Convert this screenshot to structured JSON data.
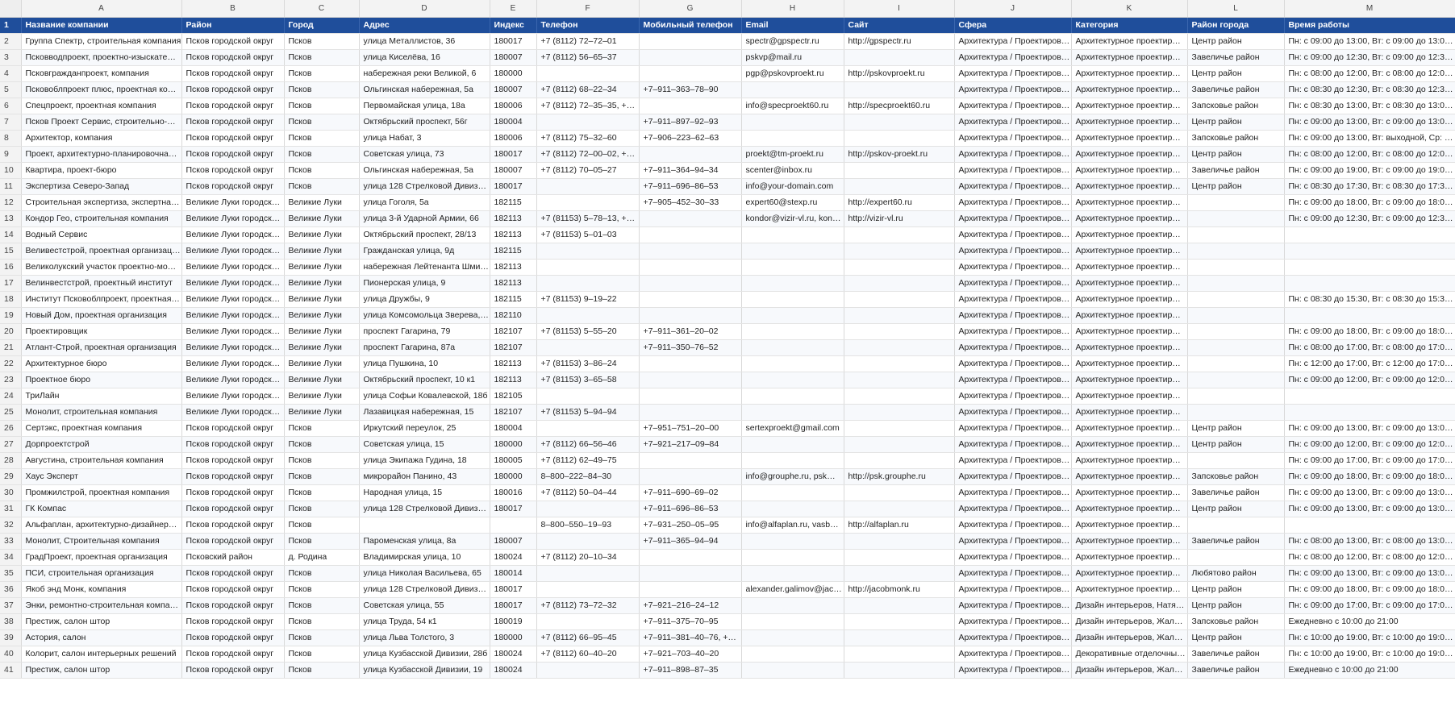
{
  "columns": [
    "A",
    "B",
    "C",
    "D",
    "E",
    "F",
    "G",
    "H",
    "I",
    "J",
    "K",
    "L",
    "M"
  ],
  "header": {
    "row_num": "1",
    "cells": [
      "Название компании",
      "Район",
      "Город",
      "Адрес",
      "Индекс",
      "Телефон",
      "Мобильный телефон",
      "Email",
      "Сайт",
      "Сфера",
      "Категория",
      "Район города",
      "Время работы"
    ]
  },
  "rows": [
    {
      "n": "2",
      "c": [
        "Группа Спектр, строительная компания",
        "Псков городской округ",
        "Псков",
        "улица Металлистов, 36",
        "180017",
        "+7 (8112) 72–72–01",
        "",
        "spectr@gpspectr.ru",
        "http://gpspectr.ru",
        "Архитектура / Проектиров…",
        "Архитектурное проектир…",
        "Центр район",
        "Пн: с 09:00 до 13:00, Вт: с 09:00 до 13:00, С…"
      ]
    },
    {
      "n": "3",
      "c": [
        "Псковводпроект, проектно-изыскате…",
        "Псков городской округ",
        "Псков",
        "улица Киселёва, 16",
        "180007",
        "+7 (8112) 56–65–37",
        "",
        "pskvp@mail.ru",
        "",
        "Архитектура / Проектиров…",
        "Архитектурное проектир…",
        "Завеличье район",
        "Пн: с 09:00 до 12:30, Вт: с 09:00 до 12:30, С…"
      ]
    },
    {
      "n": "4",
      "c": [
        "Псковгражданпроект, компания",
        "Псков городской округ",
        "Псков",
        "набережная реки Великой, 6",
        "180000",
        "",
        "",
        "pgp@pskovproekt.ru",
        "http://pskovproekt.ru",
        "Архитектура / Проектиров…",
        "Архитектурное проектир…",
        "Центр район",
        "Пн: с 08:00 до 12:00, Вт: с 08:00 до 12:00, С…"
      ]
    },
    {
      "n": "5",
      "c": [
        "Псковоблпроект плюс, проектная ко…",
        "Псков городской округ",
        "Псков",
        "Ольгинская набережная, 5а",
        "180007",
        "+7 (8112) 68–22–34",
        "+7–911–363–78–90",
        "",
        "",
        "Архитектура / Проектиров…",
        "Архитектурное проектир…",
        "Завеличье район",
        "Пн: с 08:30 до 12:30, Вт: с 08:30 до 12:30, С…"
      ]
    },
    {
      "n": "6",
      "c": [
        "Спецпроект, проектная компания",
        "Псков городской округ",
        "Псков",
        "Первомайская улица, 18а",
        "180006",
        "+7 (8112) 72–35–35, +7…",
        "",
        "info@specproekt60.ru",
        "http://specproekt60.ru",
        "Архитектура / Проектиров…",
        "Архитектурное проектир…",
        "Запсковье район",
        "Пн: с 08:30 до 13:00, Вт: с 08:30 до 13:00, С…"
      ]
    },
    {
      "n": "7",
      "c": [
        "Псков Проект Сервис, строительно-м…",
        "Псков городской округ",
        "Псков",
        "Октябрьский проспект, 56г",
        "180004",
        "",
        "+7–911–897–92–93",
        "",
        "",
        "Архитектура / Проектиров…",
        "Архитектурное проектир…",
        "Центр район",
        "Пн: с 09:00 до 13:00, Вт: с 09:00 до 13:00, С…"
      ]
    },
    {
      "n": "8",
      "c": [
        "Архитектор, компания",
        "Псков городской округ",
        "Псков",
        "улица Набат, 3",
        "180006",
        "+7 (8112) 75–32–60",
        "+7–906–223–62–63",
        "",
        "",
        "Архитектура / Проектиров…",
        "Архитектурное проектир…",
        "Запсковье район",
        "Пн: с 09:00 до 13:00, Вт: выходной, Ср: с 0…"
      ]
    },
    {
      "n": "9",
      "c": [
        "Проект, архитектурно-планировочна…",
        "Псков городской округ",
        "Псков",
        "Советская улица, 73",
        "180017",
        "+7 (8112) 72–00–02, +7…",
        "",
        "proekt@tm-proekt.ru",
        "http://pskov-proekt.ru",
        "Архитектура / Проектиров…",
        "Архитектурное проектир…",
        "Центр район",
        "Пн: с 08:00 до 12:00, Вт: с 08:00 до 12:00, С…"
      ]
    },
    {
      "n": "10",
      "c": [
        "Квартира, проект-бюро",
        "Псков городской округ",
        "Псков",
        "Ольгинская набережная, 5а",
        "180007",
        "+7 (8112) 70–05–27",
        "+7–911–364–94–34",
        "scenter@inbox.ru",
        "",
        "Архитектура / Проектиров…",
        "Архитектурное проектир…",
        "Завеличье район",
        "Пн: с 09:00 до 19:00, Вт: с 09:00 до 19:00, С…"
      ]
    },
    {
      "n": "11",
      "c": [
        "Экспертиза Северо-Запад",
        "Псков городской округ",
        "Псков",
        "улица 128 Стрелковой Дивизи…",
        "180017",
        "",
        "+7–911–696–86–53",
        "info@your-domain.com",
        "",
        "Архитектура / Проектиров…",
        "Архитектурное проектир…",
        "Центр район",
        "Пн: с 08:30 до 17:30, Вт: с 08:30 до 17:30, С…"
      ]
    },
    {
      "n": "12",
      "c": [
        "Строительная экспертиза, экспертная…",
        "Великие Луки городск…",
        "Великие Луки",
        "улица Гоголя, 5а",
        "182115",
        "",
        "+7–905–452–30–33",
        "expert60@stexp.ru",
        "http://expert60.ru",
        "Архитектура / Проектиров…",
        "Архитектурное проектир…",
        "",
        "Пн: с 09:00 до 18:00, Вт: с 09:00 до 18:00, С…"
      ]
    },
    {
      "n": "13",
      "c": [
        "Кондор Гео, строительная компания",
        "Великие Луки городск…",
        "Великие Луки",
        "улица 3-й Ударной Армии, 66",
        "182113",
        "+7 (81153) 5–78–13, +7…",
        "",
        "kondor@vizir-vl.ru, kon…",
        "http://vizir-vl.ru",
        "Архитектура / Проектиров…",
        "Архитектурное проектир…",
        "",
        "Пн: с 09:00 до 12:30, Вт: с 09:00 до 12:30, С…"
      ]
    },
    {
      "n": "14",
      "c": [
        "Водный Сервис",
        "Великие Луки городск…",
        "Великие Луки",
        "Октябрьский проспект, 28/13",
        "182113",
        "+7 (81153) 5–01–03",
        "",
        "",
        "",
        "Архитектура / Проектиров…",
        "Архитектурное проектир…",
        "",
        ""
      ]
    },
    {
      "n": "15",
      "c": [
        "Веливестстрой, проектная организация",
        "Великие Луки городск…",
        "Великие Луки",
        "Гражданская улица, 9д",
        "182115",
        "",
        "",
        "",
        "",
        "Архитектура / Проектиров…",
        "Архитектурное проектир…",
        "",
        ""
      ]
    },
    {
      "n": "16",
      "c": [
        "Великолукский участок проектно-мо…",
        "Великие Луки городск…",
        "Великие Луки",
        "набережная Лейтенанта Шми…",
        "182113",
        "",
        "",
        "",
        "",
        "Архитектура / Проектиров…",
        "Архитектурное проектир…",
        "",
        ""
      ]
    },
    {
      "n": "17",
      "c": [
        "Велинвестстрой, проектный институт",
        "Великие Луки городск…",
        "Великие Луки",
        "Пионерская улица, 9",
        "182113",
        "",
        "",
        "",
        "",
        "Архитектура / Проектиров…",
        "Архитектурное проектир…",
        "",
        ""
      ]
    },
    {
      "n": "18",
      "c": [
        "Институт Псковоблпроект, проектная…",
        "Великие Луки городск…",
        "Великие Луки",
        "улица Дружбы, 9",
        "182115",
        "+7 (81153) 9–19–22",
        "",
        "",
        "",
        "Архитектура / Проектиров…",
        "Архитектурное проектир…",
        "",
        "Пн: с 08:30 до 15:30, Вт: с 08:30 до 15:30, С…"
      ]
    },
    {
      "n": "19",
      "c": [
        "Новый Дом, проектная организация",
        "Великие Луки городск…",
        "Великие Луки",
        "улица Комсомольца Зверева, …",
        "182110",
        "",
        "",
        "",
        "",
        "Архитектура / Проектиров…",
        "Архитектурное проектир…",
        "",
        ""
      ]
    },
    {
      "n": "20",
      "c": [
        "Проектировщик",
        "Великие Луки городск…",
        "Великие Луки",
        "проспект Гагарина, 79",
        "182107",
        "+7 (81153) 5–55–20",
        "+7–911–361–20–02",
        "",
        "",
        "Архитектура / Проектиров…",
        "Архитектурное проектир…",
        "",
        "Пн: с 09:00 до 18:00, Вт: с 09:00 до 18:00, С…"
      ]
    },
    {
      "n": "21",
      "c": [
        "Атлант-Строй, проектная организация",
        "Великие Луки городск…",
        "Великие Луки",
        "проспект Гагарина, 87а",
        "182107",
        "",
        "+7–911–350–76–52",
        "",
        "",
        "Архитектура / Проектиров…",
        "Архитектурное проектир…",
        "",
        "Пн: с 08:00 до 17:00, Вт: с 08:00 до 17:00, С…"
      ]
    },
    {
      "n": "22",
      "c": [
        "Архитектурное бюро",
        "Великие Луки городск…",
        "Великие Луки",
        "улица Пушкина, 10",
        "182113",
        "+7 (81153) 3–86–24",
        "",
        "",
        "",
        "Архитектура / Проектиров…",
        "Архитектурное проектир…",
        "",
        "Пн: с 12:00 до 17:00, Вт: с 12:00 до 17:00, С…"
      ]
    },
    {
      "n": "23",
      "c": [
        "Проектное бюро",
        "Великие Луки городск…",
        "Великие Луки",
        "Октябрьский проспект, 10 к1",
        "182113",
        "+7 (81153) 3–65–58",
        "",
        "",
        "",
        "Архитектура / Проектиров…",
        "Архитектурное проектир…",
        "",
        "Пн: с 09:00 до 12:00, Вт: с 09:00 до 12:00, С…"
      ]
    },
    {
      "n": "24",
      "c": [
        "ТриЛайн",
        "Великие Луки городск…",
        "Великие Луки",
        "улица Софьи Ковалевской, 18б",
        "182105",
        "",
        "",
        "",
        "",
        "Архитектура / Проектиров…",
        "Архитектурное проектир…",
        "",
        ""
      ]
    },
    {
      "n": "25",
      "c": [
        "Монолит, строительная компания",
        "Великие Луки городск…",
        "Великие Луки",
        "Лазавицкая набережная, 15",
        "182107",
        "+7 (81153) 5–94–94",
        "",
        "",
        "",
        "Архитектура / Проектиров…",
        "Архитектурное проектир…",
        "",
        ""
      ]
    },
    {
      "n": "26",
      "c": [
        "Сертэкс, проектная компания",
        "Псков городской округ",
        "Псков",
        "Иркутский переулок, 25",
        "180004",
        "",
        "+7–951–751–20–00",
        "sertexproekt@gmail.com",
        "",
        "Архитектура / Проектиров…",
        "Архитектурное проектир…",
        "Центр район",
        "Пн: с 09:00 до 13:00, Вт: с 09:00 до 13:00, С…"
      ]
    },
    {
      "n": "27",
      "c": [
        "Дорпроектстрой",
        "Псков городской округ",
        "Псков",
        "Советская улица, 15",
        "180000",
        "+7 (8112) 66–56–46",
        "+7–921–217–09–84",
        "",
        "",
        "Архитектура / Проектиров…",
        "Архитектурное проектир…",
        "Центр район",
        "Пн: с 09:00 до 12:00, Вт: с 09:00 до 12:00, С…"
      ]
    },
    {
      "n": "28",
      "c": [
        "Августина, строительная компания",
        "Псков городской округ",
        "Псков",
        "улица Экипажа Гудина, 18",
        "180005",
        "+7 (8112) 62–49–75",
        "",
        "",
        "",
        "Архитектура / Проектиров…",
        "Архитектурное проектир…",
        "",
        "Пн: с 09:00 до 17:00, Вт: с 09:00 до 17:00, С…"
      ]
    },
    {
      "n": "29",
      "c": [
        "Хаус Эксперт",
        "Псков городской округ",
        "Псков",
        "микрорайон Панино, 43",
        "180000",
        "8–800–222–84–30",
        "",
        "info@grouphe.ru, psk@…",
        "http://psk.grouphe.ru",
        "Архитектура / Проектиров…",
        "Архитектурное проектир…",
        "Запсковье район",
        "Пн: с 09:00 до 18:00, Вт: с 09:00 до 18:00, С…"
      ]
    },
    {
      "n": "30",
      "c": [
        "Промжилстрой, проектная компания",
        "Псков городской округ",
        "Псков",
        "Народная улица, 15",
        "180016",
        "+7 (8112) 50–04–44",
        "+7–911–690–69–02",
        "",
        "",
        "Архитектура / Проектиров…",
        "Архитектурное проектир…",
        "Завеличье район",
        "Пн: с 09:00 до 13:00, Вт: с 09:00 до 13:00, С…"
      ]
    },
    {
      "n": "31",
      "c": [
        "ГК Компас",
        "Псков городской округ",
        "Псков",
        "улица 128 Стрелковой Дивизи…",
        "180017",
        "",
        "+7–911–696–86–53",
        "",
        "",
        "Архитектура / Проектиров…",
        "Архитектурное проектир…",
        "Центр район",
        "Пн: с 09:00 до 13:00, Вт: с 09:00 до 13:00, С…"
      ]
    },
    {
      "n": "32",
      "c": [
        "Альфаплан, архитектурно-дизайнерск…",
        "Псков городской округ",
        "Псков",
        "",
        "",
        "8–800–550–19–93",
        "+7–931–250–05–95",
        "info@alfaplan.ru, vasb…",
        "http://alfaplan.ru",
        "Архитектура / Проектиров…",
        "Архитектурное проектир…",
        "",
        ""
      ]
    },
    {
      "n": "33",
      "c": [
        "Монолит, Строительная компания",
        "Псков городской округ",
        "Псков",
        "Пароменская улица, 8а",
        "180007",
        "",
        "+7–911–365–94–94",
        "",
        "",
        "Архитектура / Проектиров…",
        "Архитектурное проектир…",
        "Завеличье район",
        "Пн: с 08:00 до 13:00, Вт: с 08:00 до 13:00, С…"
      ]
    },
    {
      "n": "34",
      "c": [
        "ГрадПроект, проектная организация",
        "Псковский район",
        "д. Родина",
        "Владимирская улица, 10",
        "180024",
        "+7 (8112) 20–10–34",
        "",
        "",
        "",
        "Архитектура / Проектиров…",
        "Архитектурное проектир…",
        "",
        "Пн: с 08:00 до 12:00, Вт: с 08:00 до 12:00, С…"
      ]
    },
    {
      "n": "35",
      "c": [
        "ПСИ, строительная организация",
        "Псков городской округ",
        "Псков",
        "улица Николая Васильева, 65",
        "180014",
        "",
        "",
        "",
        "",
        "Архитектура / Проектиров…",
        "Архитектурное проектир…",
        "Любятово район",
        "Пн: с 09:00 до 13:00, Вт: с 09:00 до 13:00, С…"
      ]
    },
    {
      "n": "36",
      "c": [
        "Якоб энд Монк, компания",
        "Псков городской округ",
        "Псков",
        "улица 128 Стрелковой Дивизи…",
        "180017",
        "",
        "",
        "alexander.galimov@jac…",
        "http://jacobmonk.ru",
        "Архитектура / Проектиров…",
        "Архитектурное проектир…",
        "Центр район",
        "Пн: с 09:00 до 18:00, Вт: с 09:00 до 18:00, С…"
      ]
    },
    {
      "n": "37",
      "c": [
        "Энки, ремонтно-строительная компа…",
        "Псков городской округ",
        "Псков",
        "Советская улица, 55",
        "180017",
        "+7 (8112) 73–72–32",
        "+7–921–216–24–12",
        "",
        "",
        "Архитектура / Проектиров…",
        "Дизайн интерьеров, Натя…",
        "Центр район",
        "Пн: с 09:00 до 17:00, Вт: с 09:00 до 17:00, С…"
      ]
    },
    {
      "n": "38",
      "c": [
        "Престиж, салон штор",
        "Псков городской округ",
        "Псков",
        "улица Труда, 54 к1",
        "180019",
        "",
        "+7–911–375–70–95",
        "",
        "",
        "Архитектура / Проектиров…",
        "Дизайн интерьеров, Жалю…",
        "Запсковье район",
        "Ежедневно с 10:00 до 21:00"
      ]
    },
    {
      "n": "39",
      "c": [
        "Астория, салон",
        "Псков городской округ",
        "Псков",
        "улица Льва Толстого, 3",
        "180000",
        "+7 (8112) 66–95–45",
        "+7–911–381–40–76, +7…",
        "",
        "",
        "Архитектура / Проектиров…",
        "Дизайн интерьеров, Жалю…",
        "Центр район",
        "Пн: с 10:00 до 19:00, Вт: с 10:00 до 19:00, С…"
      ]
    },
    {
      "n": "40",
      "c": [
        "Колорит, салон интерьерных решений",
        "Псков городской округ",
        "Псков",
        "улица Кузбасской Дивизии, 28б",
        "180024",
        "+7 (8112) 60–40–20",
        "+7–921–703–40–20",
        "",
        "",
        "Архитектура / Проектиров…",
        "Декоративные отделочны…",
        "Завеличье район",
        "Пн: с 10:00 до 19:00, Вт: с 10:00 до 19:00, С…"
      ]
    },
    {
      "n": "41",
      "c": [
        "Престиж, салон штор",
        "Псков городской округ",
        "Псков",
        "улица Кузбасской Дивизии, 19",
        "180024",
        "",
        "+7–911–898–87–35",
        "",
        "",
        "Архитектура / Проектиров…",
        "Дизайн интерьеров, Жалю…",
        "Завеличье район",
        "Ежедневно с 10:00 до 21:00"
      ]
    }
  ]
}
